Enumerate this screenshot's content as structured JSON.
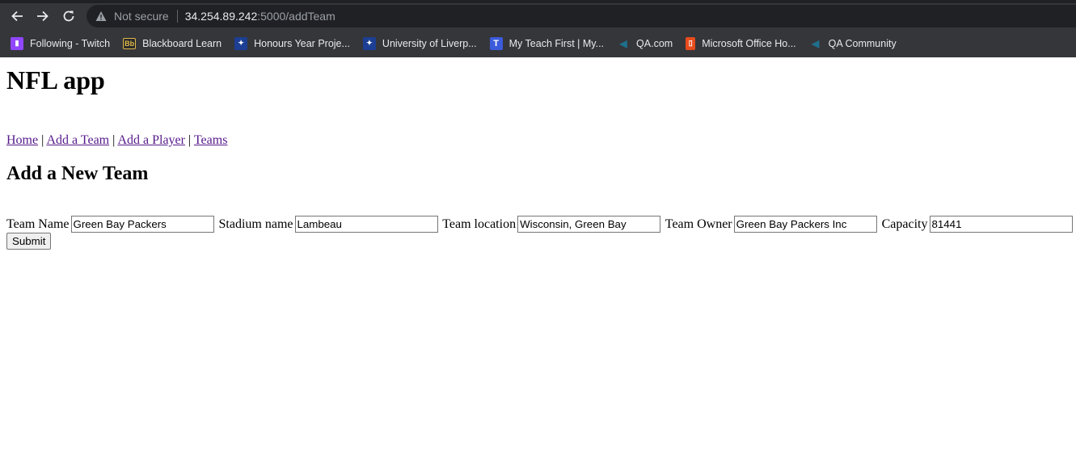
{
  "browser": {
    "not_secure": "Not secure",
    "url_host": "34.254.89.242",
    "url_path": ":5000/addTeam",
    "bookmarks": [
      {
        "label": "Following - Twitch",
        "icon": "twitch-icon",
        "color": "#9146ff"
      },
      {
        "label": "Blackboard Learn",
        "icon": "blackboard-icon",
        "color": "#e0b84a"
      },
      {
        "label": "Honours Year Proje...",
        "icon": "liverpool-bird-icon",
        "color": "#1c3f94"
      },
      {
        "label": "University of Liverp...",
        "icon": "liverpool-bird-icon",
        "color": "#1c3f94"
      },
      {
        "label": "My Teach First | My...",
        "icon": "teachfirst-icon",
        "color": "#3b5bdb"
      },
      {
        "label": "QA.com",
        "icon": "qa-icon",
        "color": "#0d3b5e"
      },
      {
        "label": "Microsoft Office Ho...",
        "icon": "office-icon",
        "color": "#e74c1c"
      },
      {
        "label": "QA Community",
        "icon": "qa-icon",
        "color": "#0d3b5e"
      }
    ]
  },
  "page": {
    "title": "NFL app",
    "nav": {
      "home": "Home",
      "add_team": "Add a Team",
      "add_player": "Add a Player",
      "teams": "Teams",
      "separator": "|"
    },
    "heading": "Add a New Team",
    "form": {
      "team_name_label": "Team Name",
      "team_name_value": "Green Bay Packers",
      "stadium_label": "Stadium name",
      "stadium_value": "Lambeau",
      "location_label": "Team location",
      "location_value": "Wisconsin, Green Bay",
      "owner_label": "Team Owner",
      "owner_value": "Green Bay Packers Inc",
      "capacity_label": "Capacity",
      "capacity_value": "81441",
      "submit_label": "Submit"
    }
  }
}
